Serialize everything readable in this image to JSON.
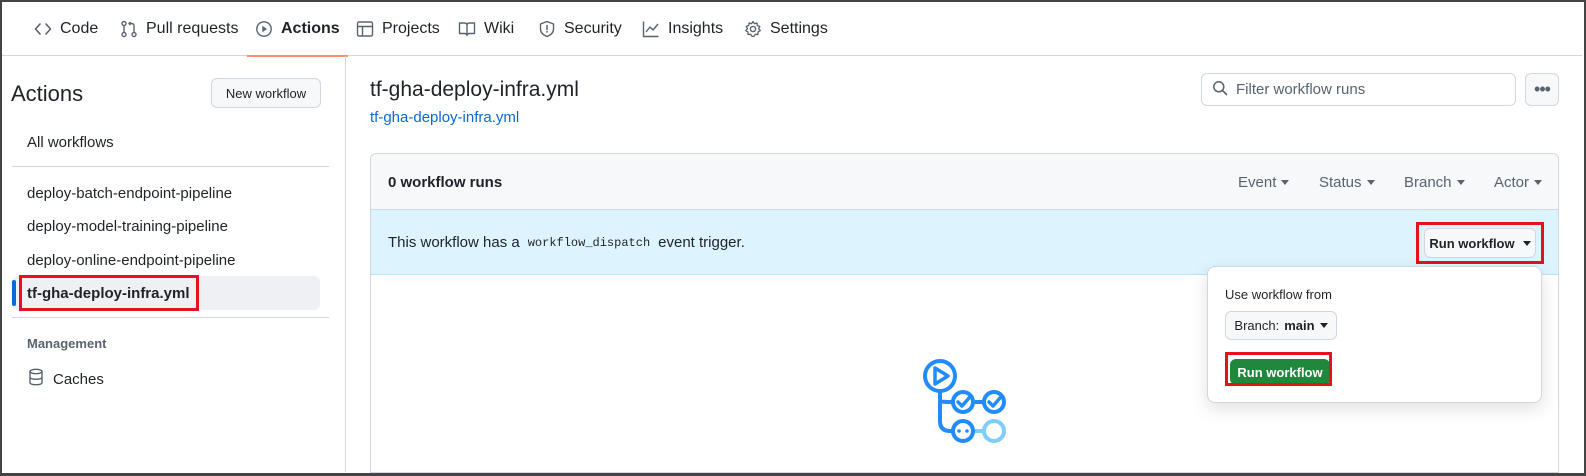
{
  "nav": {
    "tabs": [
      {
        "label": "Code",
        "icon": "code-icon"
      },
      {
        "label": "Pull requests",
        "icon": "pull-request-icon"
      },
      {
        "label": "Actions",
        "icon": "play-icon",
        "active": true
      },
      {
        "label": "Projects",
        "icon": "table-icon"
      },
      {
        "label": "Wiki",
        "icon": "book-icon"
      },
      {
        "label": "Security",
        "icon": "shield-icon"
      },
      {
        "label": "Insights",
        "icon": "graph-icon"
      },
      {
        "label": "Settings",
        "icon": "gear-icon"
      }
    ]
  },
  "sidebar": {
    "title": "Actions",
    "new_workflow": "New workflow",
    "all_workflows": "All workflows",
    "workflows": [
      "deploy-batch-endpoint-pipeline",
      "deploy-model-training-pipeline",
      "deploy-online-endpoint-pipeline",
      "tf-gha-deploy-infra.yml"
    ],
    "management_heading": "Management",
    "caches": "Caches"
  },
  "main": {
    "title": "tf-gha-deploy-infra.yml",
    "file_link": "tf-gha-deploy-infra.yml",
    "filter_placeholder": "Filter workflow runs",
    "runs_count": "0 workflow runs",
    "filters": [
      "Event",
      "Status",
      "Branch",
      "Actor"
    ],
    "dispatch_prefix": "This workflow has a",
    "dispatch_code": "workflow_dispatch",
    "dispatch_suffix": "event trigger.",
    "run_workflow_button": "Run workflow"
  },
  "popover": {
    "label": "Use workflow from",
    "branch_prefix": "Branch:",
    "branch_value": "main",
    "submit": "Run workflow"
  },
  "colors": {
    "accent_blue": "#0969da",
    "green": "#1f883d",
    "highlight_red": "#e3121c",
    "dispatch_bg": "#ddf4ff",
    "tab_underline": "#fd8c73"
  }
}
